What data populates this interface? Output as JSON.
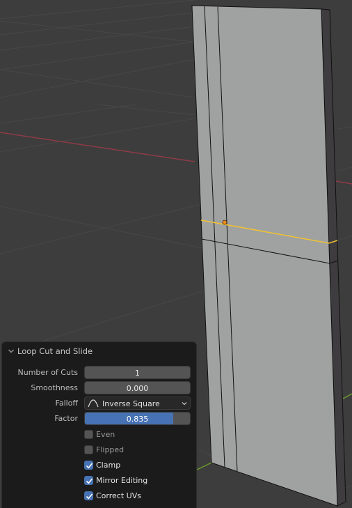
{
  "viewport": {
    "background": "#3d3d3d",
    "grid_color": "#4a4a4a",
    "x_axis_color": "#8e3b46",
    "y_axis_color": "#6b9a2b",
    "mesh_face_color": "#a0a2a2",
    "mesh_side_color": "#3e3c3e",
    "edge_color": "#111111",
    "selected_loop_color": "#f2c230",
    "active_vertex_color": "#f08a1c",
    "mode": "edit-mode"
  },
  "operator_panel": {
    "title": "Loop Cut and Slide",
    "collapse_icon": "chevron-down-icon",
    "fields": {
      "number_of_cuts": {
        "label": "Number of Cuts",
        "value": "1"
      },
      "smoothness": {
        "label": "Smoothness",
        "value": "0.000"
      },
      "falloff": {
        "label": "Falloff",
        "value": "Inverse Square",
        "icon": "inverse-square-curve-icon"
      },
      "factor": {
        "label": "Factor",
        "value": "0.835",
        "fraction": 0.835
      }
    },
    "checkboxes": [
      {
        "label": "Even",
        "checked": false
      },
      {
        "label": "Flipped",
        "checked": false
      },
      {
        "label": "Clamp",
        "checked": true
      },
      {
        "label": "Mirror Editing",
        "checked": true
      },
      {
        "label": "Correct UVs",
        "checked": true
      }
    ],
    "accent_color": "#4772b3"
  }
}
